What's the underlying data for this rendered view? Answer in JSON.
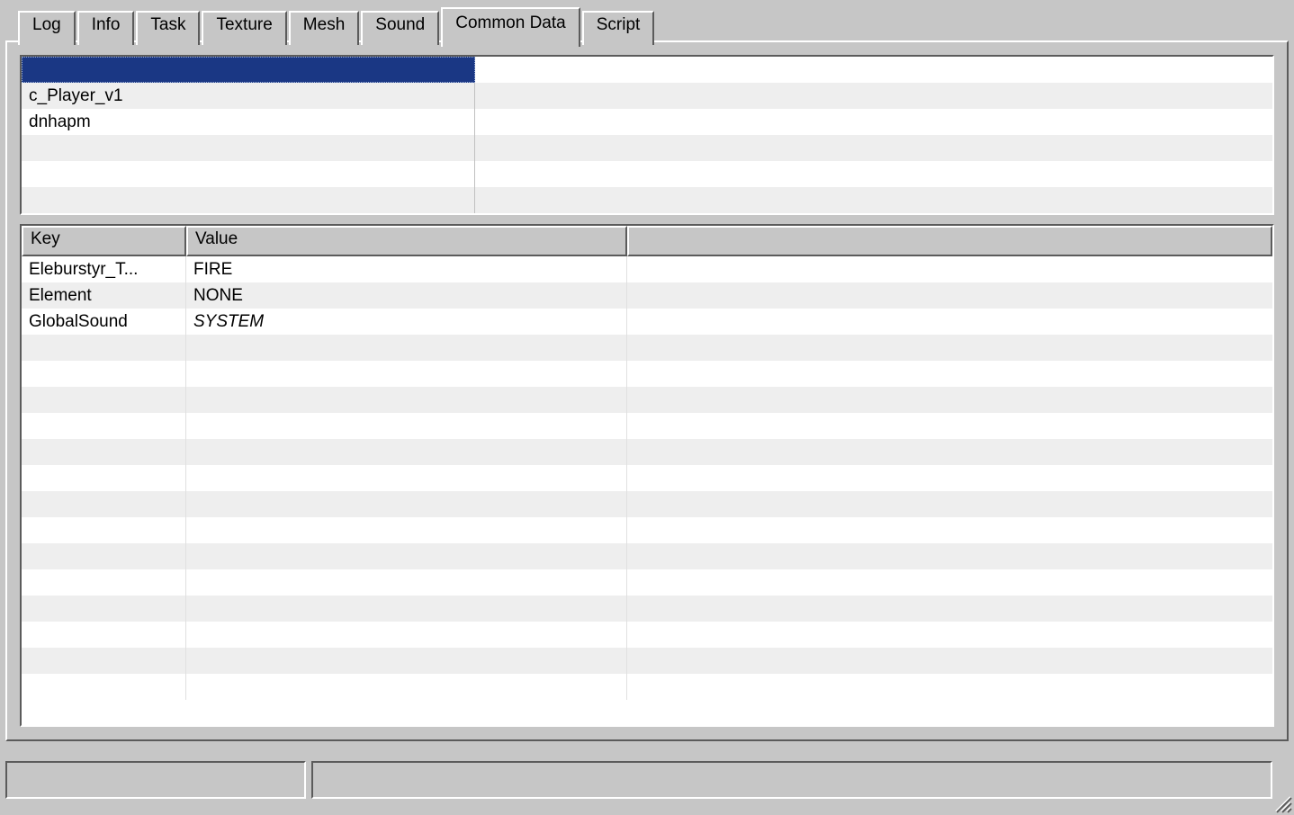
{
  "tabs": [
    {
      "label": "Log",
      "active": false
    },
    {
      "label": "Info",
      "active": false
    },
    {
      "label": "Task",
      "active": false
    },
    {
      "label": "Texture",
      "active": false
    },
    {
      "label": "Mesh",
      "active": false
    },
    {
      "label": "Sound",
      "active": false
    },
    {
      "label": "Common Data",
      "active": true
    },
    {
      "label": "Script",
      "active": false
    }
  ],
  "upperList": {
    "rows": [
      {
        "colA": "",
        "colB": "",
        "selected": true
      },
      {
        "colA": "c_Player_v1",
        "colB": ""
      },
      {
        "colA": "dnhapm",
        "colB": ""
      },
      {
        "colA": "",
        "colB": ""
      },
      {
        "colA": "",
        "colB": ""
      },
      {
        "colA": "",
        "colB": ""
      }
    ]
  },
  "kvTable": {
    "headers": {
      "key": "Key",
      "value": "Value"
    },
    "rows": [
      {
        "key": "Eleburstyr_T...",
        "value": "FIRE",
        "italic": false
      },
      {
        "key": "Element",
        "value": "NONE",
        "italic": false
      },
      {
        "key": "GlobalSound",
        "value": "SYSTEM",
        "italic": true
      },
      {
        "key": "",
        "value": ""
      },
      {
        "key": "",
        "value": ""
      },
      {
        "key": "",
        "value": ""
      },
      {
        "key": "",
        "value": ""
      },
      {
        "key": "",
        "value": ""
      },
      {
        "key": "",
        "value": ""
      },
      {
        "key": "",
        "value": ""
      },
      {
        "key": "",
        "value": ""
      },
      {
        "key": "",
        "value": ""
      },
      {
        "key": "",
        "value": ""
      },
      {
        "key": "",
        "value": ""
      },
      {
        "key": "",
        "value": ""
      },
      {
        "key": "",
        "value": ""
      },
      {
        "key": "",
        "value": ""
      }
    ]
  },
  "statusbar": {
    "pane1": "",
    "pane2": ""
  }
}
